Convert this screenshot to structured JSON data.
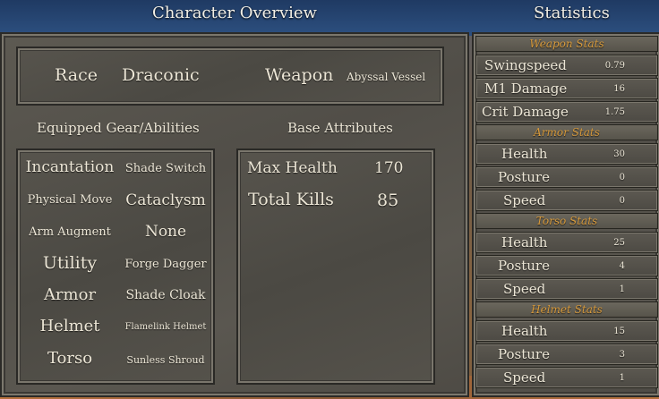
{
  "character_overview": {
    "title": "Character Overview",
    "race_label": "Race",
    "race_value": "Draconic",
    "weapon_label": "Weapon",
    "weapon_value": "Abyssal Vessel",
    "gear_heading": "Equipped Gear/Abilities",
    "gear": [
      {
        "left": "Incantation",
        "right": "Shade Switch"
      },
      {
        "left": "Physical Move",
        "right": "Cataclysm"
      },
      {
        "left": "Arm Augment",
        "right": "None"
      },
      {
        "left": "Utility",
        "right": "Forge Dagger"
      },
      {
        "left": "Armor",
        "right": "Shade Cloak"
      },
      {
        "left": "Helmet",
        "right": "Flamelink Helmet"
      },
      {
        "left": "Torso",
        "right": "Sunless Shroud"
      }
    ],
    "attributes_heading": "Base Attributes",
    "attributes": [
      {
        "label": "Max Health",
        "value": "170"
      },
      {
        "label": "Total Kills",
        "value": "85"
      }
    ]
  },
  "statistics": {
    "title": "Statistics",
    "weapon_header": "Weapon Stats",
    "weapon": [
      {
        "label": "Swingspeed",
        "value": "0.79"
      },
      {
        "label": "M1 Damage",
        "value": "16"
      },
      {
        "label": "Crit Damage",
        "value": "1.75"
      }
    ],
    "armor_header": "Armor Stats",
    "armor": [
      {
        "label": "Health",
        "value": "30"
      },
      {
        "label": "Posture",
        "value": "0"
      },
      {
        "label": "Speed",
        "value": "0"
      }
    ],
    "torso_header": "Torso Stats",
    "torso": [
      {
        "label": "Health",
        "value": "25"
      },
      {
        "label": "Posture",
        "value": "4"
      },
      {
        "label": "Speed",
        "value": "1"
      }
    ],
    "helmet_header": "Helmet Stats",
    "helmet": [
      {
        "label": "Health",
        "value": "15"
      },
      {
        "label": "Posture",
        "value": "3"
      },
      {
        "label": "Speed",
        "value": "1"
      }
    ]
  }
}
